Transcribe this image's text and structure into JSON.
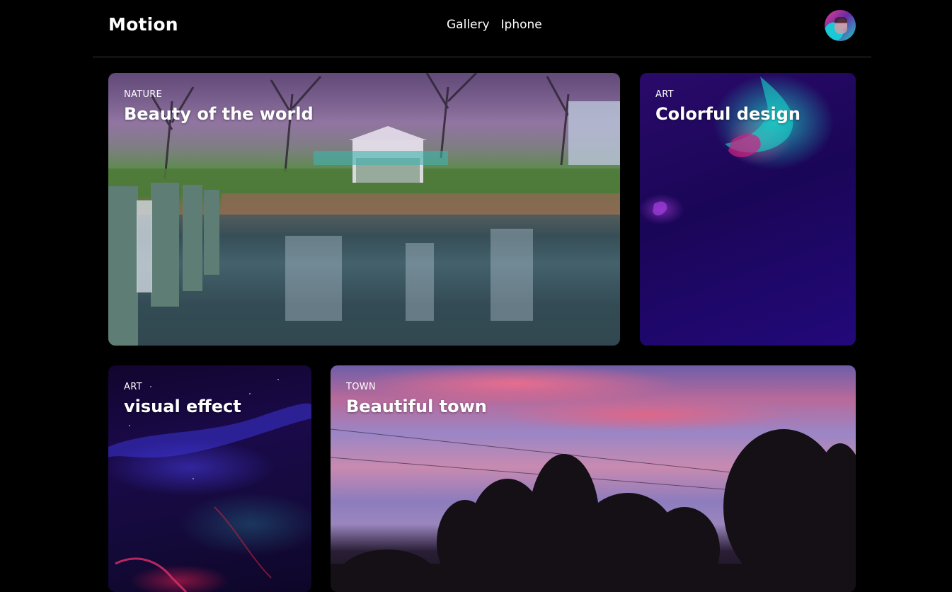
{
  "header": {
    "logo": "Motion",
    "nav": [
      {
        "label": "Gallery"
      },
      {
        "label": "Iphone"
      }
    ]
  },
  "cards": [
    {
      "tag": "NATURE",
      "title": "Beauty of the world"
    },
    {
      "tag": "ART",
      "title": "Colorful design"
    },
    {
      "tag": "ART",
      "title": "visual effect"
    },
    {
      "tag": "TOWN",
      "title": "Beautiful town"
    }
  ],
  "colors": {
    "background": "#000000",
    "text": "#ffffff",
    "divider": "#3a3a3a"
  }
}
